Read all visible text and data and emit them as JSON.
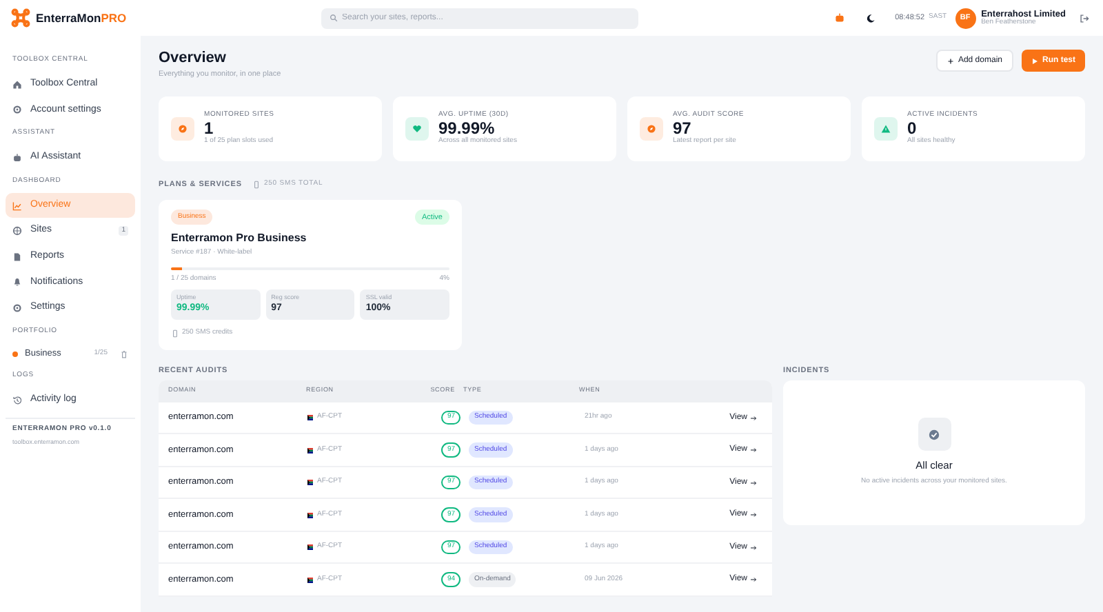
{
  "brand": {
    "name": "EnterraMon",
    "suffix": "PRO"
  },
  "sidebar": {
    "sections": [
      {
        "heading": "TOOLBOX CENTRAL",
        "items": [
          {
            "label": "Toolbox Central",
            "selected": false
          },
          {
            "label": "Account settings",
            "selected": false
          }
        ]
      },
      {
        "heading": "ASSISTANT",
        "items": [
          {
            "label": "AI Assistant",
            "selected": false
          }
        ]
      },
      {
        "heading": "DASHBOARD",
        "items": [
          {
            "label": "Overview",
            "selected": true
          },
          {
            "label": "Sites",
            "selected": false,
            "badge": "1"
          },
          {
            "label": "Reports",
            "selected": false
          },
          {
            "label": "Notifications",
            "selected": false
          },
          {
            "label": "Settings",
            "selected": false
          }
        ]
      }
    ],
    "portfolio": {
      "heading": "PORTFOLIO",
      "items": [
        {
          "label": "Business",
          "count": "1/25",
          "color": "#f97316"
        }
      ]
    },
    "logs": {
      "heading": "LOGS",
      "items": [
        {
          "label": "Activity log",
          "selected": false
        }
      ]
    },
    "footer": {
      "version": "ENTERRAMON PRO v0.1.0",
      "url": "toolbox.enterramon.com"
    }
  },
  "header": {
    "search_placeholder": "Search your sites, reports...",
    "time": "08:48:52",
    "timezone": "SAST",
    "avatar": "BF",
    "user": "Enterrahost Limited",
    "user_sub": "Ben Featherstone"
  },
  "page": {
    "title": "Overview",
    "subtitle": "Everything you monitor, in one place",
    "buttons": [
      {
        "label": "Add domain",
        "kind": "secondary"
      },
      {
        "label": "Run test",
        "kind": "primary"
      }
    ]
  },
  "stats": [
    {
      "label": "MONITORED SITES",
      "value": "1",
      "sub": "1 of 25 plan slots used",
      "color": "#f97316"
    },
    {
      "label": "AVG. UPTIME (30D)",
      "value": "99.99%",
      "sub": "Across all monitored sites",
      "color": "#10b981"
    },
    {
      "label": "AVG. AUDIT SCORE",
      "value": "97",
      "sub": "Latest report per site",
      "color": "#f97316"
    },
    {
      "label": "ACTIVE INCIDENTS",
      "value": "0",
      "sub": "All sites healthy",
      "color": "#10b981"
    }
  ],
  "plans": {
    "heading": "PLANS & SERVICES",
    "sms_total": "250 SMS TOTAL",
    "cards": [
      {
        "tag": "Business",
        "status": "Active",
        "title": "Enterramon Pro Business",
        "sub": "Service #187 · White-label",
        "level": 0.04,
        "domains": "1 / 25 domains",
        "percent": "4%",
        "metrics": [
          {
            "label": "Uptime",
            "value": "99.99%",
            "color": "#10b981"
          },
          {
            "label": "Reg score",
            "value": "97",
            "color": "#1f2937"
          },
          {
            "label": "SSL valid",
            "value": "100%",
            "color": "#1f2937"
          }
        ],
        "sms": "250 SMS credits"
      }
    ]
  },
  "audits": {
    "heading": "RECENT AUDITS",
    "columns": [
      "DOMAIN",
      "REGION",
      "SCORE",
      "TYPE",
      "WHEN"
    ],
    "rows": [
      {
        "domain": "enterramon.com",
        "region": "AF-CPT",
        "score": "97",
        "type": "Scheduled",
        "kind": "scheduled",
        "when": "21hr ago",
        "action": "View"
      },
      {
        "domain": "enterramon.com",
        "region": "AF-CPT",
        "score": "97",
        "type": "Scheduled",
        "kind": "scheduled",
        "when": "1 days ago",
        "action": "View"
      },
      {
        "domain": "enterramon.com",
        "region": "AF-CPT",
        "score": "97",
        "type": "Scheduled",
        "kind": "scheduled",
        "when": "1 days ago",
        "action": "View"
      },
      {
        "domain": "enterramon.com",
        "region": "AF-CPT",
        "score": "97",
        "type": "Scheduled",
        "kind": "scheduled",
        "when": "1 days ago",
        "action": "View"
      },
      {
        "domain": "enterramon.com",
        "region": "AF-CPT",
        "score": "97",
        "type": "Scheduled",
        "kind": "scheduled",
        "when": "1 days ago",
        "action": "View"
      },
      {
        "domain": "enterramon.com",
        "region": "AF-CPT",
        "score": "94",
        "type": "On-demand",
        "kind": "on-demand",
        "when": "09 Jun 2026",
        "action": "View"
      }
    ]
  },
  "incidents": {
    "heading": "INCIDENTS",
    "title": "All clear",
    "sub": "No active incidents across your monitored sites."
  }
}
